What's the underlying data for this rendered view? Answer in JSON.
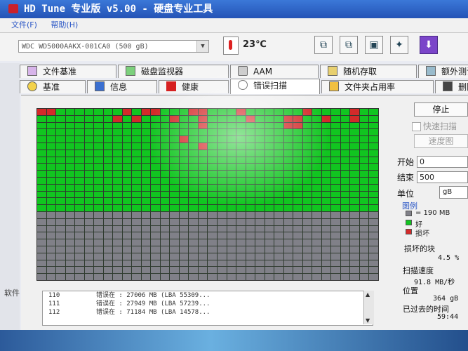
{
  "window": {
    "title": "HD Tune 专业版 v5.00 - 硬盘专业工具"
  },
  "menu": {
    "file": "文件(F)",
    "help": "帮助(H)"
  },
  "toolbar": {
    "drive": "WDC WD5000AAKX-001CA0 (500 gB)",
    "temperature": "23℃",
    "buttons": [
      "copy-info",
      "copy-screen",
      "save-screen",
      "options",
      "exit"
    ]
  },
  "tabs_row1": [
    "文件基准",
    "磁盘监视器",
    "AAM",
    "随机存取",
    "额外测试"
  ],
  "tabs_row2": [
    "基准",
    "信息",
    "健康",
    "错误扫描",
    "文件夹占用率",
    "删除"
  ],
  "active_tab": "错误扫描",
  "scan": {
    "columns": 36,
    "rows": 25,
    "scanned_rows": 15,
    "bad_blocks": [
      [
        0,
        0
      ],
      [
        0,
        1
      ],
      [
        0,
        9
      ],
      [
        0,
        11
      ],
      [
        0,
        12
      ],
      [
        0,
        16
      ],
      [
        0,
        17
      ],
      [
        0,
        21
      ],
      [
        0,
        28
      ],
      [
        0,
        33
      ],
      [
        1,
        8
      ],
      [
        1,
        10
      ],
      [
        1,
        14
      ],
      [
        1,
        17
      ],
      [
        1,
        22
      ],
      [
        1,
        26
      ],
      [
        1,
        27
      ],
      [
        1,
        30
      ],
      [
        1,
        33
      ],
      [
        2,
        17
      ],
      [
        2,
        26
      ],
      [
        2,
        27
      ],
      [
        4,
        15
      ],
      [
        5,
        17
      ]
    ]
  },
  "log": [
    {
      "num": "110",
      "msg": "错误在 :  27006 MB (LBA 55309..."
    },
    {
      "num": "111",
      "msg": "错误在 :  27949 MB (LBA 57239..."
    },
    {
      "num": "112",
      "msg": "错误在 :  71184 MB (LBA 14578..."
    }
  ],
  "controls": {
    "stop": "停止",
    "quick_scan": "快速扫描",
    "speed_map": "速度图",
    "start_label": "开始",
    "start_value": "0",
    "end_label": "结束",
    "end_value": "500",
    "unit_label": "单位",
    "unit_value": "gB"
  },
  "legend": {
    "title": "图例",
    "block_size": "= 190 MB",
    "good": "好",
    "bad": "损坏",
    "colors": {
      "block": "#808088",
      "good": "#11c520",
      "bad": "#d32a2a"
    }
  },
  "stats": {
    "bad_blocks_label": "损坏的块",
    "bad_blocks_value": "4.5 %",
    "scan_speed_label": "扫描速度",
    "scan_speed_value": "91.8 MB/秒",
    "position_label": "位置",
    "position_value": "364 gB",
    "elapsed_label": "已过去的时间",
    "elapsed_value": "59:44"
  },
  "side": {
    "software_label": "软件"
  }
}
